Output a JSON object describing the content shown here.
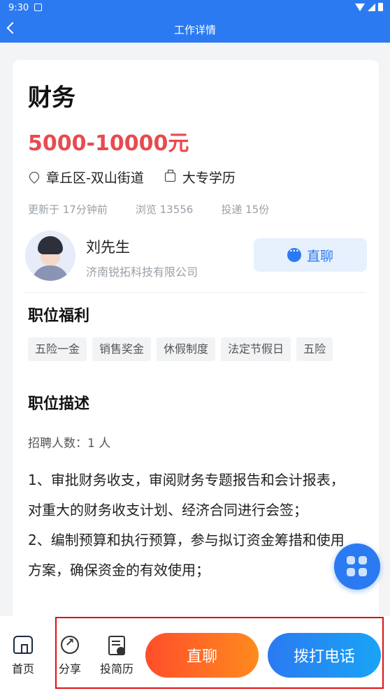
{
  "status_bar": {
    "time": "9:30"
  },
  "app_bar": {
    "title": "工作详情"
  },
  "job": {
    "title": "财务",
    "salary": "5000-10000元",
    "location": "章丘区-双山街道",
    "education": "大专学历",
    "updated": "更新于 17分钟前",
    "views": "浏览 13556",
    "applications": "投递 15份"
  },
  "contact": {
    "name": "刘先生",
    "company": "济南锐拓科技有限公司",
    "chat_label": "直聊"
  },
  "benefits": {
    "title": "职位福利",
    "tags": [
      "五险一金",
      "销售奖金",
      "休假制度",
      "法定节假日",
      "五险"
    ]
  },
  "description": {
    "title": "职位描述",
    "recruit_count": "招聘人数：1 人",
    "line1": "1、审批财务收支，审阅财务专题报告和会计报表，对重大的财务收支计划、经济合同进行会签；",
    "line2": "2、编制预算和执行预算，参与拟订资金筹措和使用方案，确保资金的有效使用；"
  },
  "bottom_bar": {
    "home": "首页",
    "share": "分享",
    "resume": "投简历",
    "chat": "直聊",
    "call": "拨打电话"
  },
  "colors": {
    "primary": "#2b7af1",
    "salary": "#e84a4f",
    "chat_start": "#ff4e2a",
    "chat_end": "#ff8a1e"
  }
}
